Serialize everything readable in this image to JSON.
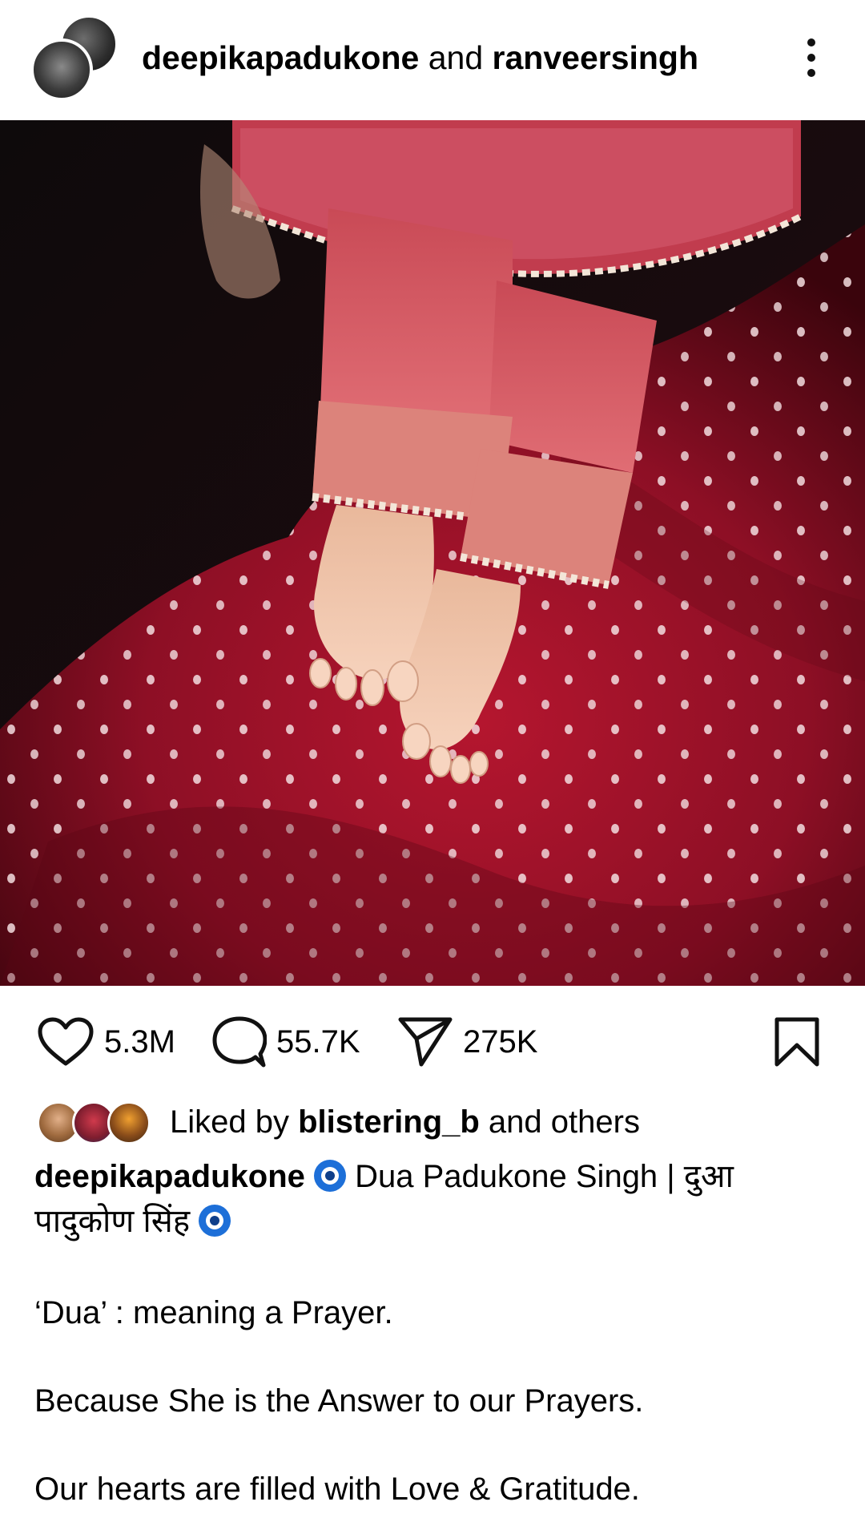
{
  "header": {
    "user1": "deepikapadukone",
    "joiner": " and ",
    "user2": "ranveersingh"
  },
  "actions": {
    "likes": "5.3M",
    "comments": "55.7K",
    "shares": "275K"
  },
  "liked_by": {
    "prefix": "Liked by ",
    "user": "blistering_b",
    "suffix": " and others"
  },
  "caption": {
    "author": "deepikapadukone",
    "line1_text": " Dua Padukone Singh | दुआ",
    "line2_text": "पादुकोण सिंह ",
    "para1": "‘Dua’ : meaning a Prayer.",
    "para2": "Because She is the Answer to our Prayers.",
    "para3": "Our hearts are filled with Love & Gratitude."
  },
  "colors": {
    "fabric": "#a3122c",
    "fabric_dark": "#4a0510",
    "kurta": "#d95a64",
    "skin": "#f2c4a8",
    "evil_eye_blue": "#1d6fd8"
  },
  "icons": [
    "heart-icon",
    "comment-icon",
    "share-icon",
    "bookmark-icon",
    "more-options-icon",
    "evil-eye-emoji"
  ]
}
